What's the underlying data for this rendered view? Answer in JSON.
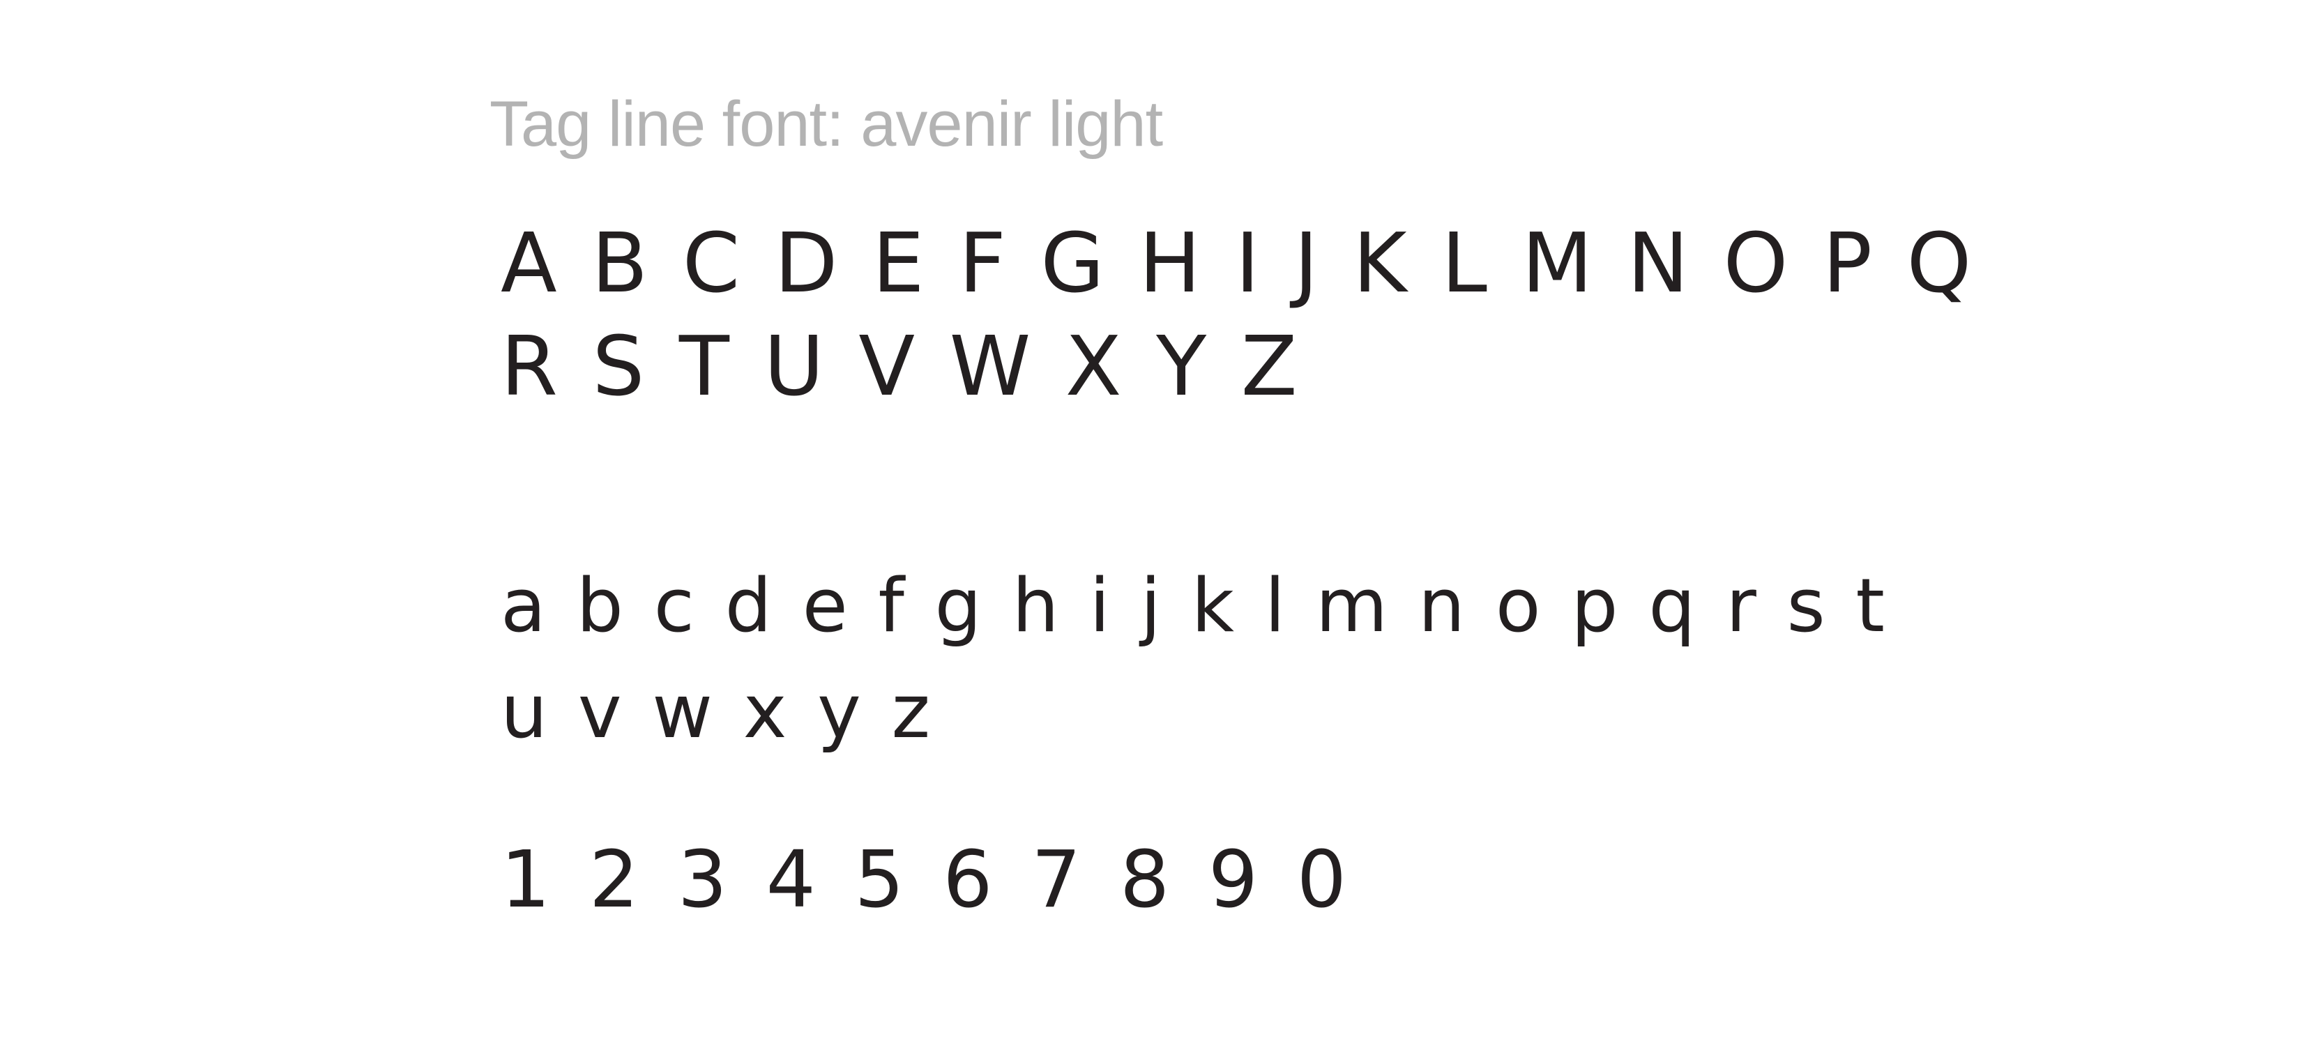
{
  "specimen": {
    "caption": "Tag line font: avenir light",
    "uppercase_line_1": "A B C D E F G H I J K L M N O P Q",
    "uppercase_line_2": "R S T U V W X Y Z",
    "lowercase_line_1": "a b c d e f g h i j k l m n o p q r s t",
    "lowercase_line_2": "u v w x y z",
    "digits": "1 2 3 4 5 6 7 8 9 0"
  },
  "colors": {
    "background": "#ffffff",
    "caption_text": "#b3b3b3",
    "glyph_text": "#231f20"
  }
}
